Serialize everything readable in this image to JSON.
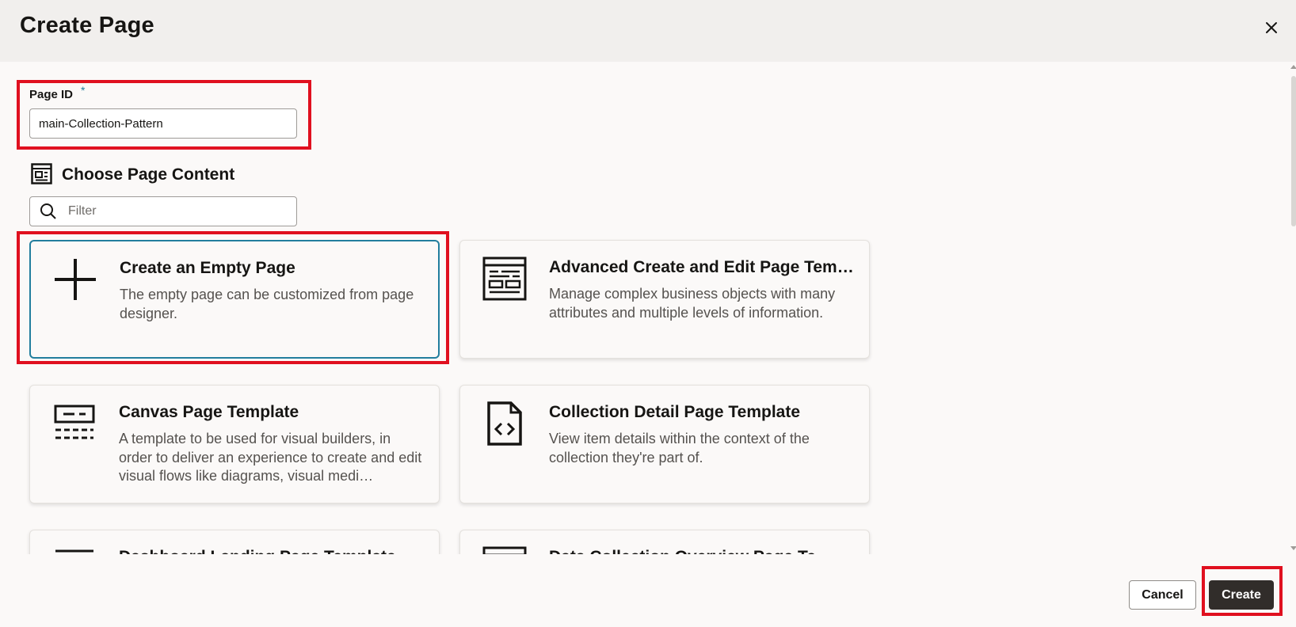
{
  "dialog": {
    "title": "Create Page",
    "close_icon": "close-icon"
  },
  "page_id": {
    "label": "Page ID",
    "required_mark": "*",
    "value": "main-Collection-Pattern"
  },
  "content": {
    "heading": "Choose Page Content",
    "heading_icon": "page-layout-icon",
    "filter_placeholder": "Filter",
    "filter_icon": "search-icon"
  },
  "templates": [
    {
      "title": "Create an Empty Page",
      "description": "The empty page can be customized from page designer.",
      "icon": "plus-icon",
      "selected": true
    },
    {
      "title": "Advanced Create and Edit Page Temp...",
      "description": "Manage complex business objects with many attributes and multiple levels of information.",
      "icon": "form-layout-icon",
      "selected": false
    },
    {
      "title": "Canvas Page Template",
      "description": "A template to be used for visual builders, in order to deliver an experience to create and edit visual flows like diagrams, visual medi…",
      "icon": "canvas-icon",
      "selected": false
    },
    {
      "title": "Collection Detail Page Template",
      "description": "View item details within the context of the collection they're part of.",
      "icon": "code-file-icon",
      "selected": false
    },
    {
      "title": "Dashboard Landing Page Template",
      "description": "",
      "icon": "dashboard-icon",
      "selected": false
    },
    {
      "title": "Data Collection Overview Page Te...",
      "description": "",
      "icon": "list-layout-icon",
      "selected": false
    }
  ],
  "footer": {
    "cancel_label": "Cancel",
    "create_label": "Create"
  },
  "colors": {
    "highlight": "#e0101f",
    "selected_border": "#227e9e",
    "primary_button": "#312d2a",
    "header_background": "#f1efed"
  }
}
